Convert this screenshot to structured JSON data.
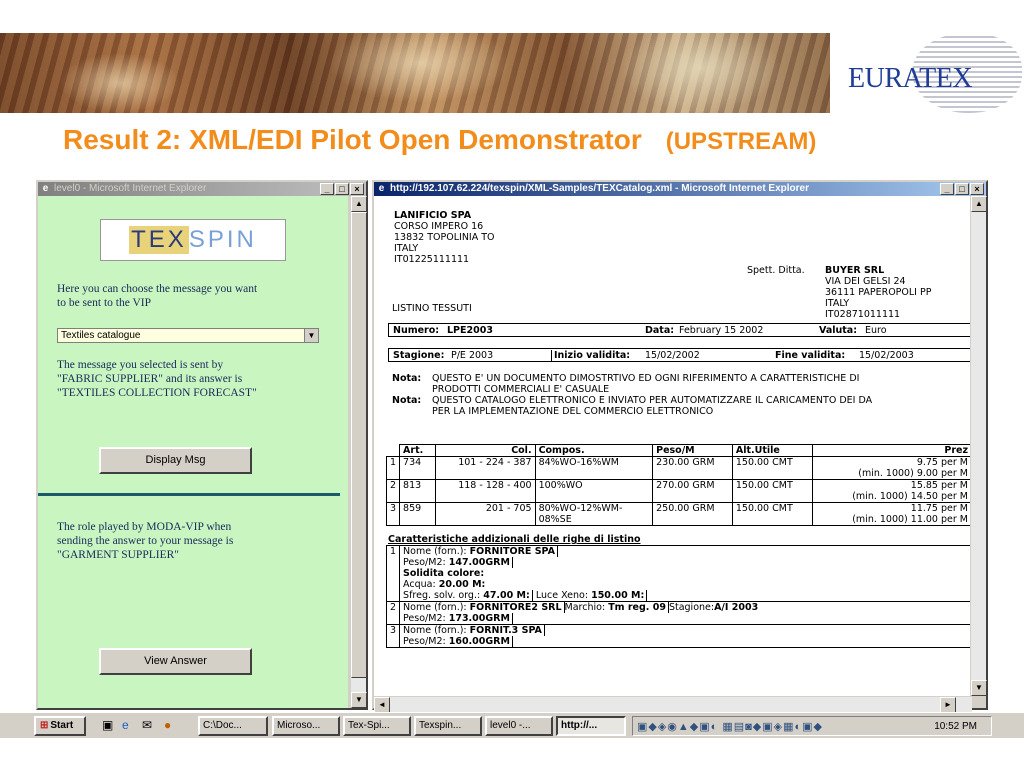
{
  "banner": {
    "logo_text": "EURATEX"
  },
  "slide": {
    "title": "Result 2: XML/EDI Pilot Open Demonstrator",
    "subtitle": "(UPSTREAM)"
  },
  "left_window": {
    "title": "level0 - Microsoft Internet Explorer",
    "logo_tex": "TEX",
    "logo_spin": "SPIN",
    "choose_text_1": "Here you can choose the message you want",
    "choose_text_2": "to be sent to the VIP",
    "select_value": "Textiles catalogue",
    "info_1": "The message you selected is sent by",
    "info_2": "\"FABRIC SUPPLIER\" and its answer is",
    "info_3": "\"TEXTILES COLLECTION FORECAST\"",
    "display_button": "Display Msg",
    "role_1": "The role played by MODA-VIP when",
    "role_2": "sending the answer to your message is",
    "role_3": "\"GARMENT SUPPLIER\"",
    "view_button": "View Answer"
  },
  "right_window": {
    "title": "http://192.107.62.224/texspin/XML-Samples/TEXCatalog.xml - Microsoft Internet Explorer",
    "sender": [
      "LANIFICIO SPA",
      "CORSO IMPERO 16",
      "13832 TOPOLINIA TO",
      "ITALY",
      "IT01225111111"
    ],
    "spett_label": "Spett. Ditta.",
    "buyer": [
      "BUYER SRL",
      "VIA DEI GELSI 24",
      "36111 PAPEROPOLI PP",
      "ITALY",
      "IT02871011111"
    ],
    "listino": "LISTINO TESSUTI",
    "numero_label": "Numero:",
    "numero_value": "LPE2003",
    "data_label": "Data:",
    "data_value": "February 15 2002",
    "valuta_label": "Valuta:",
    "valuta_value": "Euro",
    "stagione_label": "Stagione:",
    "stagione_value": "P/E 2003",
    "inizio_label": "Inizio validita:",
    "inizio_value": "15/02/2002",
    "fine_label": "Fine validita:",
    "fine_value": "15/02/2003",
    "nota_label": "Nota:",
    "nota1_line1": "QUESTO E' UN DOCUMENTO DIMOSTRTIVO ED OGNI RIFERIMENTO A CARATTERISTICHE DI",
    "nota1_line2": "PRODOTTI COMMERCIALI E' CASUALE",
    "nota2_line1": "QUESTO CATALOGO ELETTRONICO E INVIATO PER AUTOMATIZZARE IL CARICAMENTO DEI DA",
    "nota2_line2": "PER LA IMPLEMENTAZIONE DEL COMMERCIO ELETTRONICO",
    "table_headers": [
      "Art.",
      "Col.",
      "Compos.",
      "Peso/M",
      "Alt.Utile",
      "Prez"
    ],
    "rows": [
      {
        "n": "1",
        "art": "734",
        "col": "101 - 224 - 387",
        "compos": "84%WO-16%WM",
        "compos2": "",
        "peso": "230.00 GRM",
        "alt": "150.00 CMT",
        "prezzo1": "9.75 per M",
        "prezzo2": "(min. 1000) 9.00 per M"
      },
      {
        "n": "2",
        "art": "813",
        "col": "118 - 128 - 400",
        "compos": "100%WO",
        "compos2": "",
        "peso": "270.00 GRM",
        "alt": "150.00 CMT",
        "prezzo1": "15.85 per M",
        "prezzo2": "(min. 1000) 14.50 per M"
      },
      {
        "n": "3",
        "art": "859",
        "col": "201 - 705",
        "compos": "80%WO-12%WM-",
        "compos2": "08%SE",
        "peso": "250.00 GRM",
        "alt": "150.00 CMT",
        "prezzo1": "11.75 per M",
        "prezzo2": "(min. 1000) 11.00 per M"
      }
    ],
    "extra_title": "Caratteristiche addizionali delle righe di listino",
    "extra": {
      "r1_n": "1",
      "r1_nome_label": "Nome (forn.):",
      "r1_nome": "FORNITORE SPA",
      "r1_peso_label": "Peso/M2:",
      "r1_peso": "147.00GRM",
      "r1_solidita": "Solidita colore:",
      "r1_acqua_label": "Acqua:",
      "r1_acqua": "20.00 M:",
      "r1_sfreg_label": "Sfreg. solv. org.:",
      "r1_sfreg": "47.00 M:",
      "r1_luce_label": "Luce Xeno:",
      "r1_luce": "150.00 M:",
      "r2_n": "2",
      "r2_nome_label": "Nome (forn.):",
      "r2_nome": "FORNITORE2 SRL",
      "r2_marchio_label": "Marchio:",
      "r2_marchio": "Tm reg. 09",
      "r2_stagione_label": "Stagione:",
      "r2_stagione": "A/I 2003",
      "r2_peso_label": "Peso/M2:",
      "r2_peso": "173.00GRM",
      "r3_n": "3",
      "r3_nome_label": "Nome (forn.):",
      "r3_nome": "FORNIT.3 SPA",
      "r3_peso_label": "Peso/M2:",
      "r3_peso": "160.00GRM"
    }
  },
  "taskbar": {
    "start": "Start",
    "tasks": [
      "C:\\Doc...",
      "Microso...",
      "Tex-Spi...",
      "Texspin...",
      "level0 -...",
      "http://..."
    ],
    "clock": "10:52 PM"
  }
}
